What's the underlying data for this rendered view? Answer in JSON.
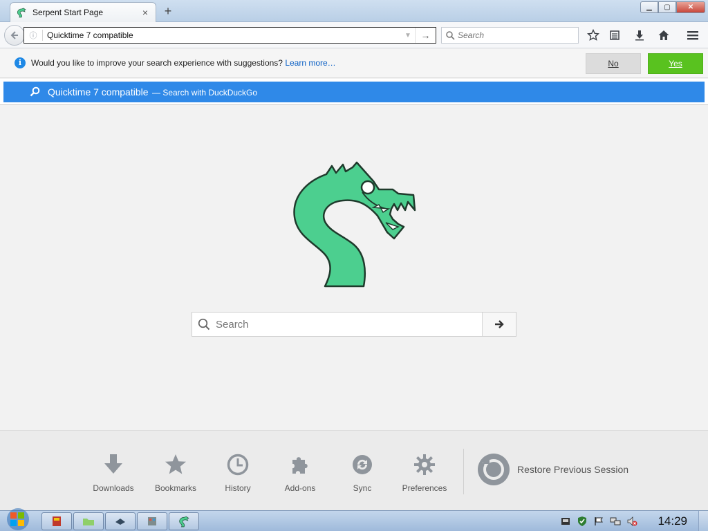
{
  "browser": {
    "tab": {
      "title": "Serpent Start Page",
      "favicon": "serpent-icon",
      "close": "×"
    },
    "new_tab": "+",
    "window_buttons": {
      "minimize": "▁",
      "maximize": "▢",
      "close": "✕"
    }
  },
  "navbar": {
    "url_value": "Quicktime 7 compatible",
    "search_placeholder": "Search"
  },
  "notification": {
    "message": "Would you like to improve your search experience with suggestions?",
    "learn_more": "Learn more…",
    "no_label": "No",
    "yes_label": "Yes"
  },
  "suggestion": {
    "query": "Quicktime 7 compatible",
    "engine_text": "— Search with DuckDuckGo"
  },
  "page": {
    "search_placeholder": "Search"
  },
  "launcher": {
    "items": [
      {
        "label": "Downloads",
        "icon": "download-icon"
      },
      {
        "label": "Bookmarks",
        "icon": "star-icon"
      },
      {
        "label": "History",
        "icon": "clock-icon"
      },
      {
        "label": "Add-ons",
        "icon": "puzzle-icon"
      },
      {
        "label": "Sync",
        "icon": "sync-icon"
      },
      {
        "label": "Preferences",
        "icon": "gear-icon"
      }
    ],
    "restore_label": "Restore Previous Session"
  },
  "taskbar": {
    "clock": "14:29"
  },
  "colors": {
    "accent_blue": "#2f89e8",
    "yes_green": "#59c21f",
    "serpent_green": "#4ccf8f"
  }
}
